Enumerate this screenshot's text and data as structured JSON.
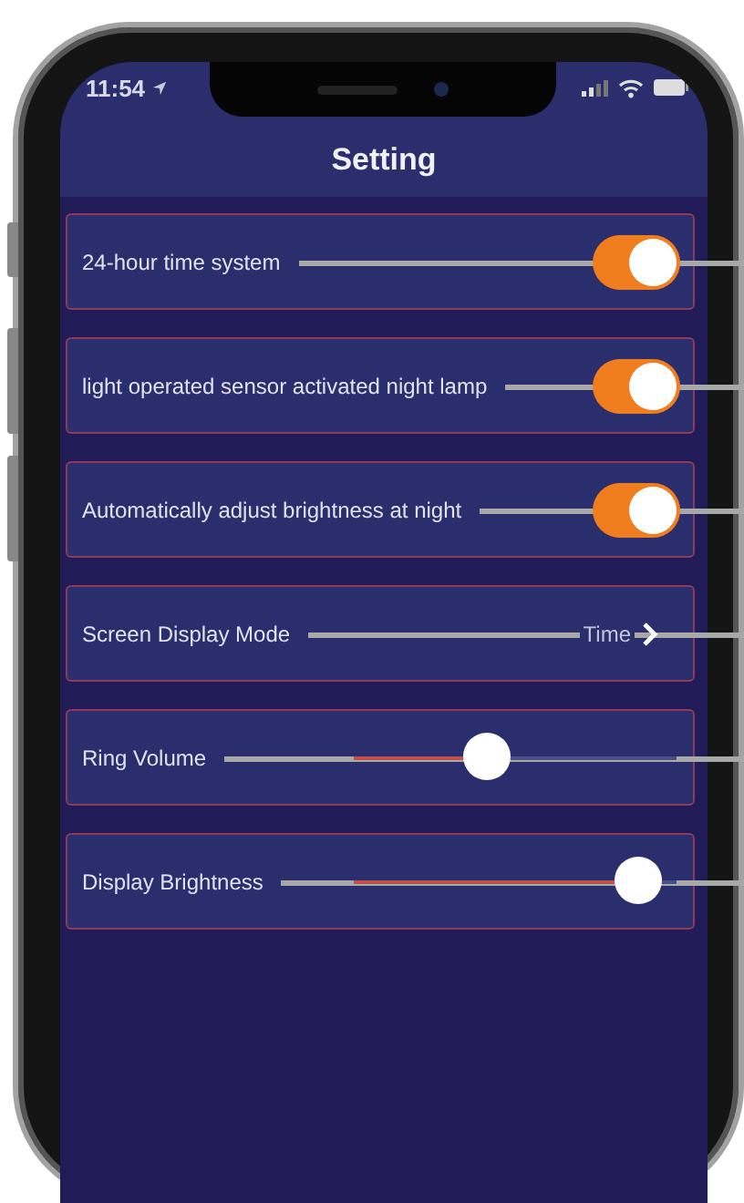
{
  "status_bar": {
    "time": "11:54"
  },
  "title": "Setting",
  "settings": [
    {
      "kind": "toggle",
      "label": "24-hour time system",
      "on": true
    },
    {
      "kind": "toggle",
      "label": "light operated sensor activated night lamp",
      "on": true
    },
    {
      "kind": "toggle",
      "label": "Automatically adjust brightness at night",
      "on": true
    },
    {
      "kind": "link",
      "label": "Screen Display Mode",
      "value": "Time"
    },
    {
      "kind": "slider",
      "label": "Ring Volume",
      "level": 0.41
    },
    {
      "kind": "slider",
      "label": "Display Brightness",
      "level": 0.88
    }
  ]
}
